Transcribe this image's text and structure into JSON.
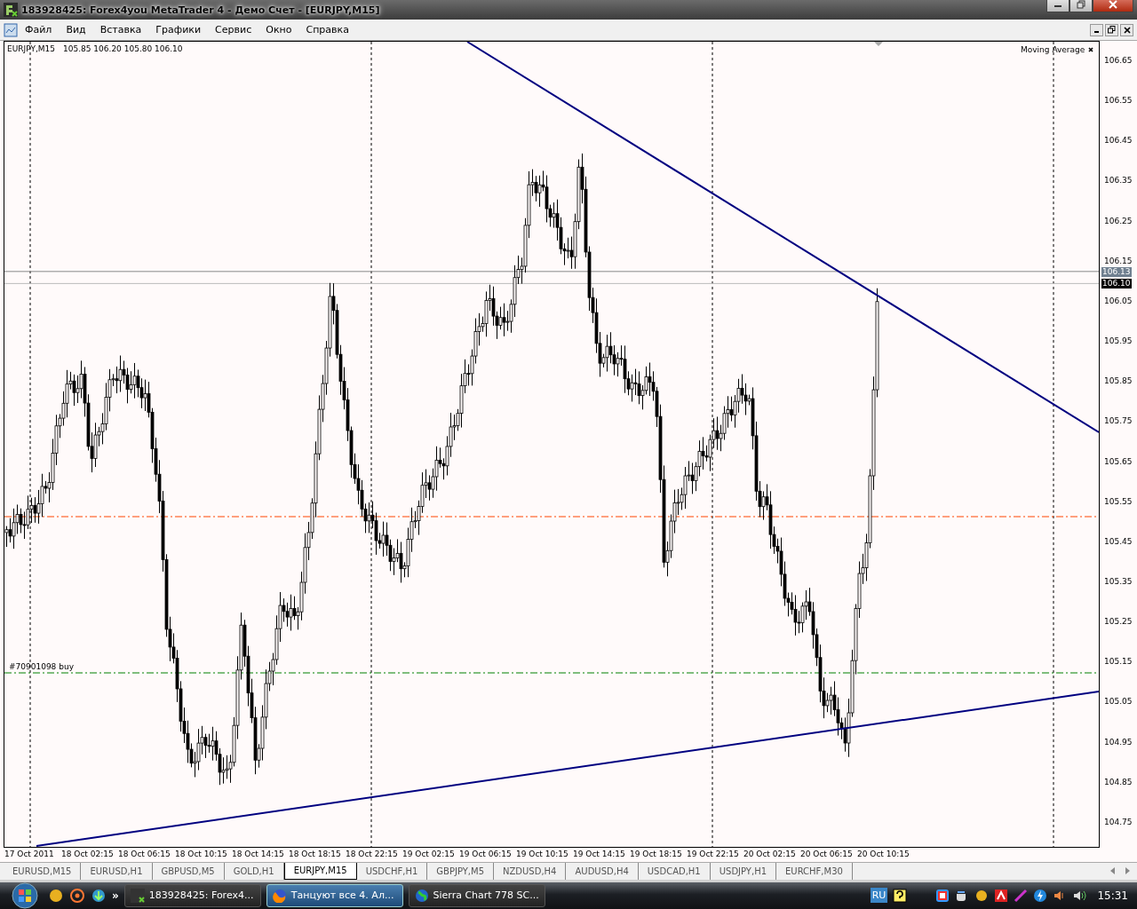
{
  "window": {
    "title": "183928425: Forex4you MetaTrader 4 - Демо Счет - [EURJPY,M15]"
  },
  "menu": [
    "Файл",
    "Вид",
    "Вставка",
    "Графики",
    "Сервис",
    "Окно",
    "Справка"
  ],
  "chart": {
    "symbol": "EURJPY,M15",
    "ohlc": "105.85 106.20 105.80 106.10",
    "indicator": "Moving Average",
    "order_label": "#70901098 buy",
    "price_labels": [
      "106.65",
      "106.55",
      "106.45",
      "106.35",
      "106.25",
      "106.15",
      "106.05",
      "105.95",
      "105.85",
      "105.75",
      "105.65",
      "105.55",
      "105.45",
      "105.35",
      "105.25",
      "105.15",
      "105.05",
      "104.95",
      "104.85",
      "104.75"
    ],
    "price_markers": [
      {
        "text": "106.13",
        "kind": "ask"
      },
      {
        "text": "106.10",
        "kind": "bid"
      }
    ],
    "time_labels": [
      "17 Oct 2011",
      "18 Oct 02:15",
      "18 Oct 06:15",
      "18 Oct 10:15",
      "18 Oct 14:15",
      "18 Oct 18:15",
      "18 Oct 22:15",
      "19 Oct 02:15",
      "19 Oct 06:15",
      "19 Oct 10:15",
      "19 Oct 14:15",
      "19 Oct 18:15",
      "19 Oct 22:15",
      "20 Oct 02:15",
      "20 Oct 06:15",
      "20 Oct 10:15"
    ]
  },
  "tabs": [
    {
      "label": "EURUSD,M15",
      "selected": false
    },
    {
      "label": "EURUSD,H1",
      "selected": false
    },
    {
      "label": "GBPUSD,M5",
      "selected": false
    },
    {
      "label": "GOLD,H1",
      "selected": false
    },
    {
      "label": "EURJPY,M15",
      "selected": true
    },
    {
      "label": "USDCHF,H1",
      "selected": false
    },
    {
      "label": "GBPJPY,M5",
      "selected": false
    },
    {
      "label": "NZDUSD,H4",
      "selected": false
    },
    {
      "label": "AUDUSD,H4",
      "selected": false
    },
    {
      "label": "USDCAD,H1",
      "selected": false
    },
    {
      "label": "USDJPY,H1",
      "selected": false
    },
    {
      "label": "EURCHF,M30",
      "selected": false
    }
  ],
  "taskbar": {
    "quick_launch_more": "»",
    "buttons": [
      {
        "label": "183928425: Forex4...",
        "selected": false,
        "kind": "metatrader"
      },
      {
        "label": "Танцуют все 4. Ал...",
        "selected": true,
        "kind": "firefox"
      },
      {
        "label": "Sierra Chart 778 SC...",
        "selected": false,
        "kind": "globe"
      }
    ],
    "language": "RU",
    "clock": "15:31"
  }
}
